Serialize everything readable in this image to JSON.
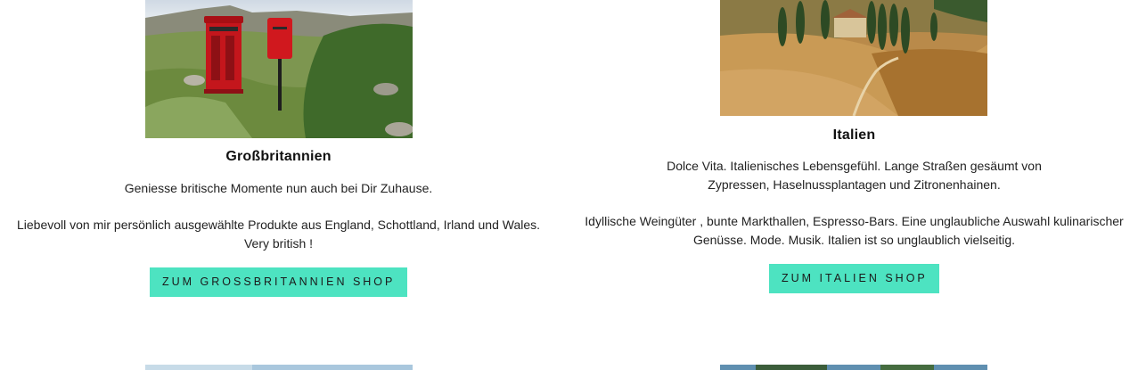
{
  "cards": [
    {
      "title": "Großbritannien",
      "paragraph1": "Geniesse britische Momente nun auch bei Dir Zuhause.",
      "paragraph2": "Liebevoll von mir persönlich ausgewählte Produkte aus England, Schottland, Irland und Wales. Very british !",
      "button_label": "ZUM GROSSBRITANNIEN SHOP",
      "image_description": "red-phone-box-and-postbox-in-highlands"
    },
    {
      "title": "Italien",
      "paragraph1": "Dolce Vita. Italienisches Lebensgefühl. Lange Straßen gesäumt von Zypressen, Haselnussplantagen und Zitronenhainen.",
      "paragraph2": "Idyllische Weingüter , bunte Markthallen, Espresso-Bars. Eine unglaubliche Auswahl kulinarischer Genüsse. Mode. Musik. Italien ist so unglaublich vielseitig.",
      "button_label": "ZUM ITALIEN SHOP",
      "image_description": "tuscany-farmhouse-with-cypress-trees"
    }
  ],
  "colors": {
    "button_bg": "#4de3c1",
    "text": "#222222",
    "background": "#ffffff"
  }
}
